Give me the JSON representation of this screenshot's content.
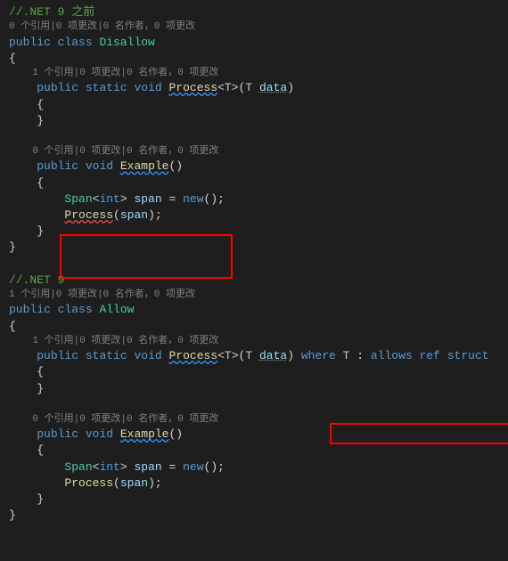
{
  "comment1": "//.NET 9 之前",
  "codelens1": "0 个引用|0 项更改|0 名作者，0 项更改",
  "class1_decl": {
    "public": "public",
    "class": "class",
    "name": "Disallow"
  },
  "brace_open": "{",
  "brace_close": "}",
  "codelens2": "1 个引用|0 项更改|0 名作者，0 项更改",
  "method1": {
    "public": "public",
    "static": "static",
    "void": "void",
    "name": "Process",
    "lt": "<",
    "tp": "T",
    "gt": ">",
    "lparen": "(",
    "ptype": "T",
    "pname": "data",
    "rparen": ")"
  },
  "codelens3": "0 个引用|0 项更改|0 名作者，0 项更改",
  "method2": {
    "public": "public",
    "void": "void",
    "name": "Example",
    "parens": "()"
  },
  "span_decl": {
    "span": "Span",
    "lt": "<",
    "int": "int",
    "gt": ">",
    "var": "span",
    "eq": " = ",
    "new": "new",
    "parens": "()",
    "semi": ";"
  },
  "process_call": {
    "name": "Process",
    "lparen": "(",
    "arg": "span",
    "rparen": ")",
    "semi": ";"
  },
  "comment2": "//.NET 9",
  "codelens4": "1 个引用|0 项更改|0 名作者，0 项更改",
  "class2_decl": {
    "public": "public",
    "class": "class",
    "name": "Allow"
  },
  "method3": {
    "where": "where",
    "tp2": "T",
    "colon": " : ",
    "allows": "allows",
    "ref": "ref",
    "struct": "struct"
  }
}
